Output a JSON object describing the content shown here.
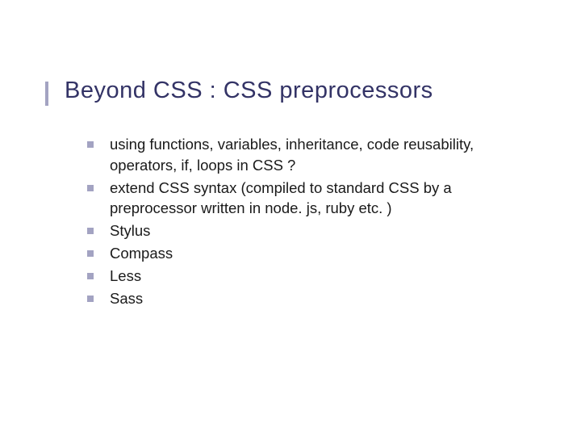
{
  "title": "Beyond CSS : CSS preprocessors",
  "bullets": [
    "using functions, variables, inheritance, code reusability, operators, if, loops in CSS ?",
    "extend CSS syntax (compiled to standard CSS by a preprocessor written in node. js, ruby etc. )",
    "Stylus",
    "Compass",
    "Less",
    "Sass"
  ]
}
